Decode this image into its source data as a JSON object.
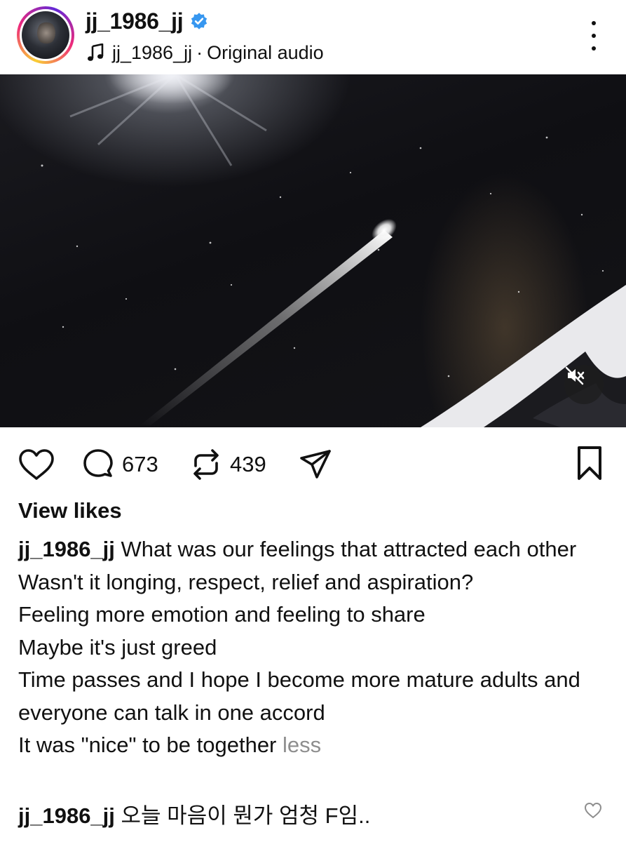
{
  "header": {
    "username": "jj_1986_jj",
    "audio_user": "jj_1986_jj",
    "audio_separator": "·",
    "audio_label": "Original audio"
  },
  "media": {
    "muted": true
  },
  "actions": {
    "comment_count": "673",
    "repost_count": "439"
  },
  "caption": {
    "view_likes": "View likes",
    "user": "jj_1986_jj",
    "lines": [
      "What was our feelings that attracted each other",
      "Wasn't it longing, respect, relief and aspiration?",
      "Feeling more emotion and feeling to share",
      "Maybe it's just greed",
      "Time passes and I hope I become more mature adults and everyone can talk in one accord",
      "It was \"nice\" to be together"
    ],
    "less_label": "less"
  },
  "comment": {
    "user": "jj_1986_jj",
    "text": "오늘 마음이 뭔가 엄청 F임.."
  },
  "colors": {
    "verified_blue": "#3797f0",
    "muted_text": "#8e8e8e"
  },
  "icons": [
    "verified-badge-icon",
    "music-note-icon",
    "more-options-icon",
    "heart-icon",
    "comment-icon",
    "repost-icon",
    "share-icon",
    "bookmark-icon",
    "mute-icon"
  ]
}
